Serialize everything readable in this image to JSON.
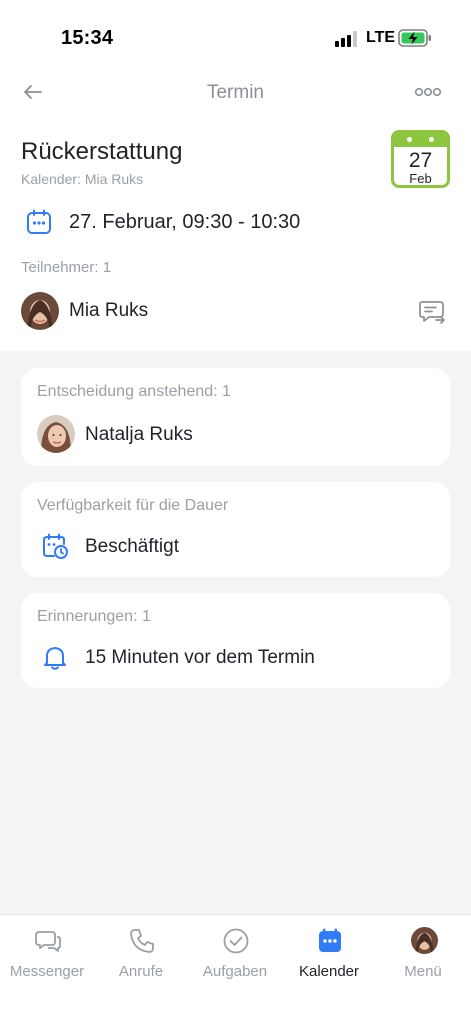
{
  "status_bar": {
    "time": "15:34",
    "network": "LTE"
  },
  "nav": {
    "title": "Termin"
  },
  "event": {
    "title": "Rückerstattung",
    "calendar": "Kalender: Mia Ruks",
    "date_badge": {
      "day": "27",
      "month": "Feb",
      "color": "#8cc63f"
    },
    "datetime": "27. Februar, 09:30 - 10:30"
  },
  "participants": {
    "label": "Teilnehmer: 1",
    "items": [
      {
        "name": "Mia Ruks"
      }
    ]
  },
  "cards": {
    "pending": {
      "label": "Entscheidung anstehend: 1",
      "name": "Natalja Ruks"
    },
    "availability": {
      "label": "Verfügbarkeit für die Dauer",
      "value": "Beschäftigt"
    },
    "reminders": {
      "label": "Erinnerungen: 1",
      "value": "15 Minuten vor dem Termin"
    }
  },
  "tabbar": {
    "items": [
      {
        "label": "Messenger",
        "icon": "chat-bubbles-icon"
      },
      {
        "label": "Anrufe",
        "icon": "phone-icon"
      },
      {
        "label": "Aufgaben",
        "icon": "check-circle-icon"
      },
      {
        "label": "Kalender",
        "icon": "calendar-icon",
        "active": true
      },
      {
        "label": "Menü",
        "icon": "avatar"
      }
    ]
  },
  "colors": {
    "accent": "#2f7cf6",
    "calendar_green": "#8cc63f",
    "muted": "#9aa0a6"
  }
}
